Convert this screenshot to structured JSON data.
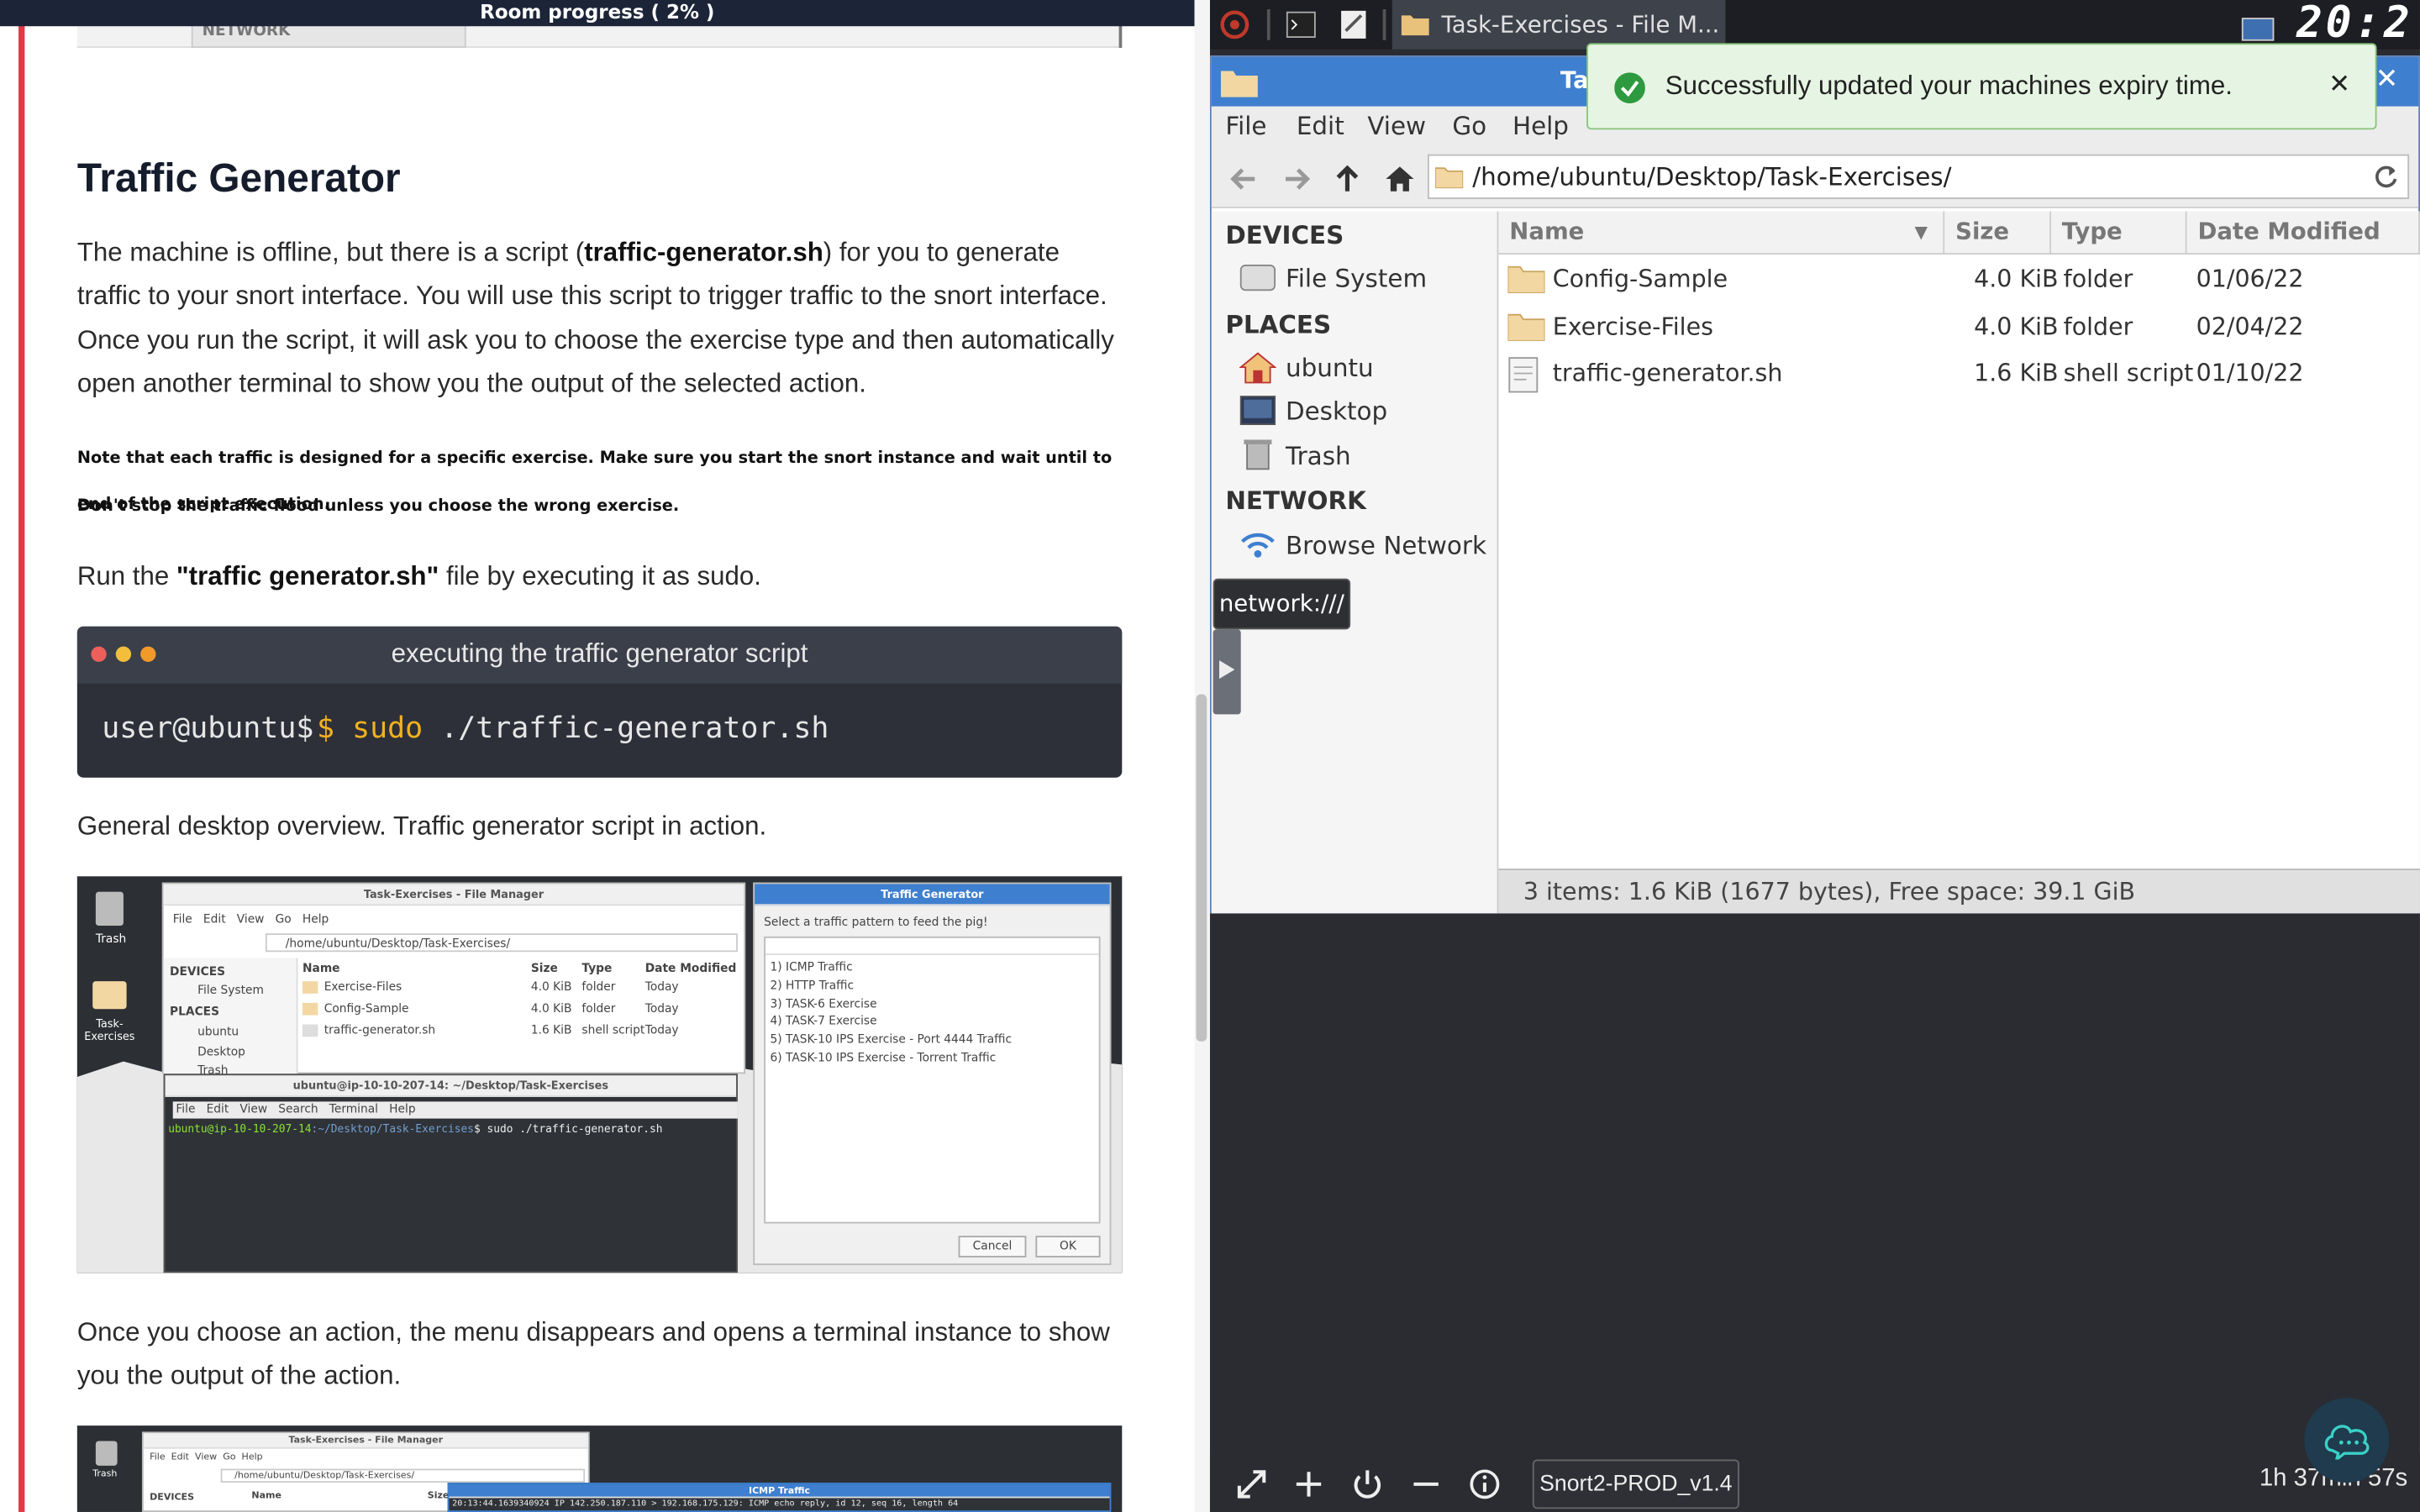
{
  "left": {
    "progress_label": "Room progress ( 2% )",
    "top_thumb_label": "NETWORK",
    "heading": "Traffic Generator",
    "para1_a": "The machine is offline, but there is a script (",
    "para1_b": "traffic-generator.sh",
    "para1_c": ") for you to generate traffic to your snort interface. You will use this script to trigger traffic to the snort interface. Once you run the script, it will ask you to choose the exercise type and then automatically open another terminal to show you the output of the selected action.",
    "note1": "Note that each traffic is designed for a specific exercise. Make sure you start the snort instance and wait until to end of the script execution.",
    "note2": "Don't stop the traffic flood unless you choose the wrong exercise.",
    "run_a": "Run the ",
    "run_b": "\"traffic generator.sh\"",
    "run_c": " file by executing it as sudo.",
    "code_title": "executing the traffic generator script",
    "code_prompt": "user@ubuntu$",
    "code_cmd1": "sudo",
    "code_cmd2": "./traffic-generator.sh",
    "caption1": "General desktop overview. Traffic generator script in action.",
    "para2": "Once you choose an action, the menu disappears and opens a terminal instance to show you the output of the action.",
    "shot1": {
      "trash": "Trash",
      "task_ex": "Task-Exercises",
      "fm_title": "Task-Exercises - File Manager",
      "menu": [
        "File",
        "Edit",
        "View",
        "Go",
        "Help"
      ],
      "path": "/home/ubuntu/Desktop/Task-Exercises/",
      "devices": "DEVICES",
      "filesystem": "File System",
      "places": "PLACES",
      "ubuntu": "ubuntu",
      "desktop": "Desktop",
      "trash2": "Trash",
      "cols": [
        "Name",
        "Size",
        "Type",
        "Date Modified"
      ],
      "rows": [
        [
          "Exercise-Files",
          "4.0 KiB",
          "folder",
          "Today"
        ],
        [
          "Config-Sample",
          "4.0 KiB",
          "folder",
          "Today"
        ],
        [
          "traffic-generator.sh",
          "1.6 KiB",
          "shell script",
          "Today"
        ]
      ],
      "term_title": "ubuntu@ip-10-10-207-14: ~/Desktop/Task-Exercises",
      "term_menu": [
        "File",
        "Edit",
        "View",
        "Search",
        "Terminal",
        "Help"
      ],
      "term_user": "ubuntu@ip-10-10-207-14",
      "term_path": ":~/Desktop/Task-Exercises",
      "term_cmd": "$ sudo ./traffic-generator.sh",
      "tg_title": "Traffic Generator",
      "tg_prompt": "Select a traffic pattern to feed the pig!",
      "tg_options": [
        "1) ICMP Traffic",
        "2) HTTP Traffic",
        "3) TASK-6 Exercise",
        "4) TASK-7 Exercise",
        "5) TASK-10 IPS Exercise - Port 4444 Traffic",
        "6) TASK-10 IPS Exercise - Torrent Traffic"
      ],
      "tg_cancel": "Cancel",
      "tg_ok": "OK"
    },
    "shot2": {
      "trash": "Trash",
      "fm_title": "Task-Exercises - File Manager",
      "menu": [
        "File",
        "Edit",
        "View",
        "Go",
        "Help"
      ],
      "path": "/home/ubuntu/Desktop/Task-Exercises/",
      "devices": "DEVICES",
      "col_name": "Name",
      "col_size": "Size",
      "icmp_title": "ICMP Traffic",
      "icmp_line": "20:13:44.1639340924 IP 142.250.187.110 > 192.168.175.129: ICMP echo reply, id 12, seq 16, length 64"
    }
  },
  "right": {
    "task_tab": "Task-Exercises - File M...",
    "clock": "20:2",
    "fm_title_partial": "Ta",
    "menu": [
      "File",
      "Edit",
      "View",
      "Go",
      "Help"
    ],
    "path": "/home/ubuntu/Desktop/Task-Exercises/",
    "sidebar": {
      "devices": "DEVICES",
      "filesystem": "File System",
      "places": "PLACES",
      "ubuntu": "ubuntu",
      "desktop": "Desktop",
      "trash": "Trash",
      "network": "NETWORK",
      "browse": "Browse Network"
    },
    "columns": [
      "Name",
      "Size",
      "Type",
      "Date Modified"
    ],
    "rows": [
      {
        "name": "Config-Sample",
        "size": "4.0 KiB",
        "type": "folder",
        "date": "01/06/22",
        "icon": "folder-icon"
      },
      {
        "name": "Exercise-Files",
        "size": "4.0 KiB",
        "type": "folder",
        "date": "02/04/22",
        "icon": "folder-icon"
      },
      {
        "name": "traffic-generator.sh",
        "size": "1.6 KiB",
        "type": "shell script",
        "date": "01/10/22",
        "icon": "script-icon"
      }
    ],
    "status": "3 items: 1.6 KiB (1677 bytes), Free space: 39.1 GiB",
    "toast": "Successfully updated your machines expiry time.",
    "tooltip": "network:///",
    "machine_name": "Snort2-PROD_v1.4",
    "timer": "1h 37min 57s"
  },
  "colors": {
    "accent_red": "#e03a47",
    "titlebar_blue": "#3e7fcf",
    "toast_green": "#2e9a3f",
    "code_yellow": "#f1b21e"
  }
}
